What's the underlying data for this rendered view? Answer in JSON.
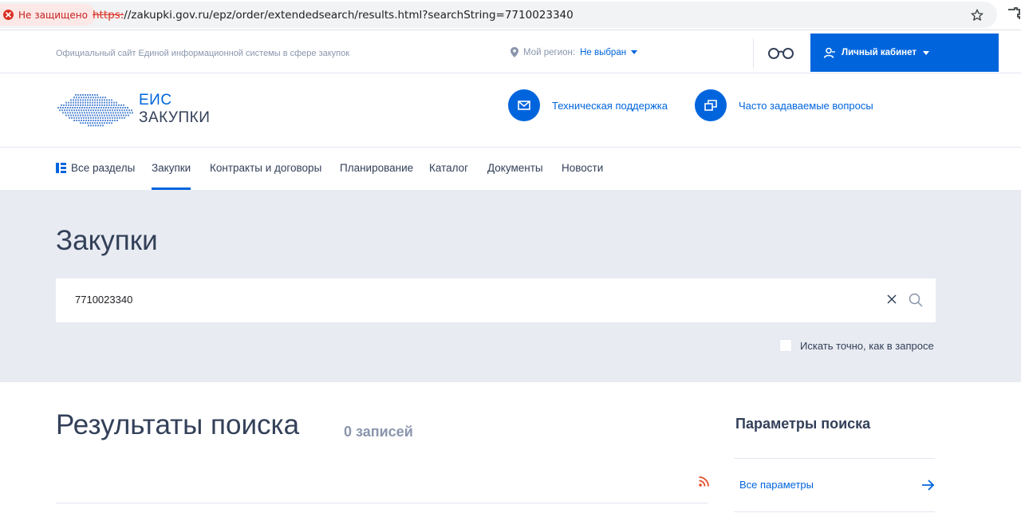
{
  "browser": {
    "security_label": "Не защищено",
    "url_scheme": "https:",
    "url_rest": "//zakupki.gov.ru/epz/order/extendedsearch/results.html?searchString=7710023340"
  },
  "top_strip": {
    "official_text": "Официальный сайт Единой информационной системы в сфере закупок",
    "region_label": "Мой регион:",
    "region_value": "Не выбран",
    "cabinet_label": "Личный кабинет"
  },
  "header": {
    "logo_line1": "ЕИС",
    "logo_line2": "ЗАКУПКИ",
    "support_label": "Техническая поддержка",
    "faq_label": "Часто задаваемые вопросы"
  },
  "nav": {
    "all_sections": "Все разделы",
    "items": [
      "Закупки",
      "Контракты и договоры",
      "Планирование",
      "Каталог",
      "Документы",
      "Новости"
    ]
  },
  "search": {
    "page_title": "Закупки",
    "query": "7710023340",
    "exact_label": "Искать точно, как в запросе"
  },
  "results": {
    "title": "Результаты поиска",
    "count": "0 записей"
  },
  "params": {
    "title": "Параметры поиска",
    "all_params": "Все параметры"
  },
  "colors": {
    "accent": "#0065dd",
    "text": "#334059",
    "muted": "#8a96ad",
    "search_bg": "#e8ebf1",
    "rss": "#e34d26"
  }
}
